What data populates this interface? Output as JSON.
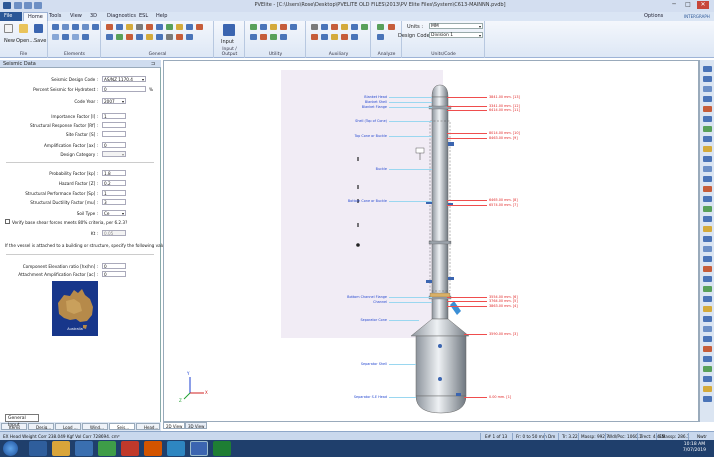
{
  "window": {
    "title": "PVElite - [C:\\Users\\Rose\\Desktop\\PVELITE OLD FILES\\2013\\PV Elite Files\\System\\C613-MAINNN.pvdb]",
    "controls": [
      "─",
      "□",
      "✕"
    ]
  },
  "ribbon_tabs": [
    "File",
    "Home",
    "Tools",
    "View",
    "3D",
    "Diagnostics",
    "ESL",
    "Help"
  ],
  "ribbon_right": {
    "options": "Options",
    "logo": "INTERGRAPH"
  },
  "ribbon_groups": {
    "file": {
      "label": "File",
      "buttons": [
        "New",
        "Open...",
        "Save"
      ]
    },
    "elements": {
      "label": "Elements"
    },
    "general": {
      "label": "General"
    },
    "input_output": {
      "label": "Input / Output",
      "input": "Input"
    },
    "utility": {
      "label": "Utility"
    },
    "auxiliary": {
      "label": "Auxiliary"
    },
    "analyze": {
      "label": "Analyze"
    },
    "units_code": {
      "label": "Units/Code",
      "units_label": "Units :",
      "units_value": "MM",
      "design_code_label": "Design Code :",
      "design_code_value": "Division 1"
    }
  },
  "seismic_panel": {
    "title": "Seismic Data",
    "pin": "⊐",
    "fields": [
      {
        "label": "Seismic Design Code :",
        "value": "AS/NZ 1170.4"
      },
      {
        "label": "Percent Seismic for Hydrotest :",
        "value": "0",
        "unit": "%"
      },
      {
        "label": "Code Year :",
        "value": "2007"
      },
      {
        "label": "Importance Factor [I] :",
        "value": "1"
      },
      {
        "label": "Structural Response Factor [Rf] :",
        "value": ""
      },
      {
        "label": "Site Factor [S] :",
        "value": ""
      },
      {
        "label": "Amplification Factor [ax] :",
        "value": "0"
      },
      {
        "label": "Design Category :",
        "value": ""
      },
      {
        "label": "Probability Factor [kp] :",
        "value": "1.8"
      },
      {
        "label": "Hazard Factor [Z] :",
        "value": "0.2"
      },
      {
        "label": "Structural Performace Factor [Sp] :",
        "value": "1"
      },
      {
        "label": "Structural Ductility Factor [mu] :",
        "value": "3"
      },
      {
        "label": "Soil Type :",
        "value": "Ce"
      }
    ],
    "verify_checkbox": "Verify base shear forces meets 80% criteria, per 6.2.3?",
    "kt_label": "Kt :",
    "kt_value": "0.05",
    "building_note": "If the vessel is attached to a building or structure, specify the following values:",
    "component_elevation_label": "Component Elevation ratio [hx/hn] :",
    "component_elevation_value": "0",
    "attachment_amp_label": "Attachment Amplification Factor [ac] :",
    "attachment_amp_value": "0",
    "map_label": "Australia",
    "tooltip": "General Input"
  },
  "drawing": {
    "blue_labels": [
      "Blanket Head",
      "Blanket Shell",
      "Blanket Flange",
      "Shell (Top of Cone)",
      "Top Cone or Buckle",
      "Buckle",
      "Bottom Cone or Buckle",
      "Bottom Channel Flange",
      "Channel",
      "Separator Cone",
      "Separator Shell",
      "Separator S.E Head"
    ],
    "red_labels": [
      "3841.00 mm. [13]",
      "3341.00 mm. [12]",
      "6414.00 mm. [11]",
      "8014.00 mm. [10]",
      "8463.00 mm. [9]",
      "6465.00 mm. [8]",
      "6574.00 mm. [7]",
      "3554.00 mm. [6]",
      "3764.00 mm. [5]",
      "3863.00 mm. [4]",
      "3590.00 mm. [3]",
      "0.00 mm. [1]"
    ],
    "view_tabs": [
      "2D View",
      "3D View"
    ],
    "axes": [
      "Y",
      "Z",
      "X"
    ]
  },
  "doc_tabs": [
    "Items",
    "Desig...",
    "Load ...",
    "Wind...",
    "Seis...",
    "Head..."
  ],
  "status_bar": {
    "left": "EX Head Weight Corr 238.049 Kgf  Vol Corr 728694. cm³",
    "items": [
      "E# 1 of 13",
      "Fr: 0 to 50 mm",
      "Dm",
      "Tr: 3.22",
      "Massp: 992.7",
      "Wdl/Psc: 1060.1",
      "Trect: 4.415",
      "EMassp: 286.1",
      "Nwtr"
    ]
  },
  "taskbar": {
    "time": "10:18 AM",
    "date": "7/07/2019"
  }
}
